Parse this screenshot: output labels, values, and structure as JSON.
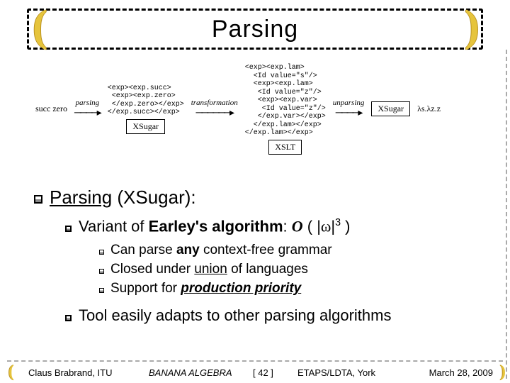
{
  "title": "Parsing",
  "diagram": {
    "input": "succ zero",
    "arrow1": "parsing",
    "box1": "XSugar",
    "code1": "<exp><exp.succ>\n <exp><exp.zero>\n </exp.zero></exp>\n</exp.succ></exp>",
    "arrow2": "transformation",
    "box2": "XSLT",
    "code2": "<exp><exp.lam>\n  <Id value=\"s\"/>\n  <exp><exp.lam>\n   <Id value=\"z\"/>\n   <exp><exp.var>\n    <Id value=\"z\"/>\n   </exp.var></exp>\n  </exp.lam></exp>\n</exp.lam></exp>",
    "arrow3": "unparsing",
    "box3": "XSugar",
    "output": "λs.λz.z"
  },
  "bullets": {
    "l1_a": "Parsing",
    "l1_b": " (XSugar):",
    "l2a": "Variant of ",
    "l2a_bold": "Earley's algorithm",
    "l2a_tail": ": ",
    "bigO": "O",
    "paren_open": " ( |",
    "omega": "ω",
    "paren_close": "|",
    "exp": "3",
    "paren_end": " )",
    "l3a_pre": "Can parse ",
    "l3a_bold": "any",
    "l3a_post": " context-free grammar",
    "l3b_pre": "Closed under ",
    "l3b_u": "union",
    "l3b_post": " of languages",
    "l3c_pre": "Support for ",
    "l3c_bold": "production priority",
    "l2b": "Tool easily adapts to other parsing algorithms"
  },
  "footer": {
    "author": "Claus Brabrand, ITU",
    "center1": "BANANA ALGEBRA",
    "page": "[ 42 ]",
    "venue": "ETAPS/LDTA, York",
    "date": "March 28, 2009"
  }
}
